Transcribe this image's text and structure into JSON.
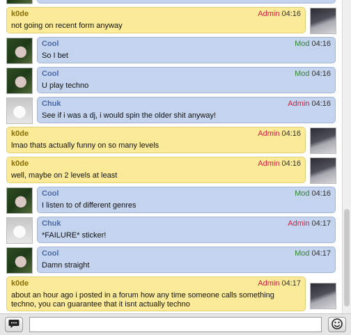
{
  "messages": [
    {
      "user": "",
      "role": "",
      "time": "",
      "text": "",
      "side": "left",
      "avatar": "cool"
    },
    {
      "user": "k0de",
      "role": "Admin",
      "time": "04:16",
      "text": "not going on recent form anyway",
      "side": "right",
      "avatar": "k0de"
    },
    {
      "user": "Cool",
      "role": "Mod",
      "time": "04:16",
      "text": "So I bet",
      "side": "left",
      "avatar": "cool"
    },
    {
      "user": "Cool",
      "role": "Mod",
      "time": "04:16",
      "text": "U play techno",
      "side": "left",
      "avatar": "cool"
    },
    {
      "user": "Chuk",
      "role": "Admin",
      "time": "04:16",
      "text": "See if i was a dj, i would spin the older shit anyway!",
      "side": "left",
      "avatar": "chuk"
    },
    {
      "user": "k0de",
      "role": "Admin",
      "time": "04:16",
      "text": "lmao thats actually funny on so many levels",
      "side": "right",
      "avatar": "k0de"
    },
    {
      "user": "k0de",
      "role": "Admin",
      "time": "04:16",
      "text": "well, maybe on 2 levels at least",
      "side": "right",
      "avatar": "k0de"
    },
    {
      "user": "Cool",
      "role": "Mod",
      "time": "04:16",
      "text": "I listen to of different genres",
      "side": "left",
      "avatar": "cool"
    },
    {
      "user": "Chuk",
      "role": "Admin",
      "time": "04:17",
      "text": "*FAILURE* sticker!",
      "side": "left",
      "avatar": "chuk"
    },
    {
      "user": "Cool",
      "role": "Mod",
      "time": "04:17",
      "text": "Damn straight",
      "side": "left",
      "avatar": "cool"
    },
    {
      "user": "k0de",
      "role": "Admin",
      "time": "04:17",
      "text": "about an hour ago i posted in a forum how any time someone calls something techno, you can guarantee that it isnt actually techno",
      "side": "right",
      "avatar": "k0de"
    }
  ],
  "input": {
    "placeholder": "",
    "value": ""
  },
  "icons": {
    "chat": "speech-bubble-icon",
    "emoji": "smiley-icon"
  },
  "colors": {
    "user_bubble": "#c4d3ee",
    "self_bubble": "#fbeb99",
    "admin": "#d21e3c",
    "mod": "#2f8a2f"
  }
}
